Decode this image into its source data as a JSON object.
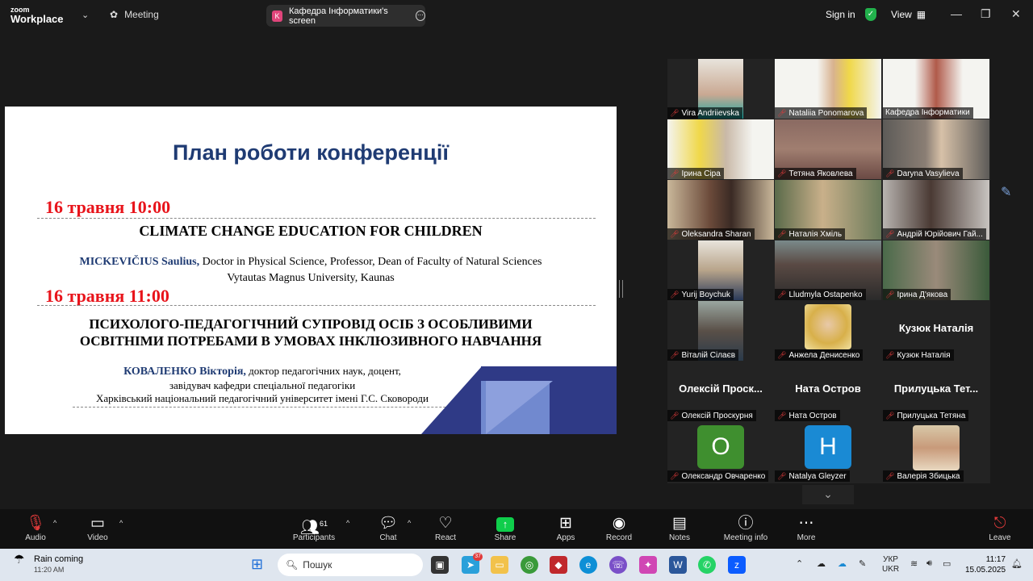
{
  "topbar": {
    "logo_line1": "zoom",
    "logo_line2": "Workplace",
    "meeting_label": "Meeting",
    "share_initial": "K",
    "share_label": "Кафедра Інформатики's screen",
    "signin": "Sign in",
    "view": "View"
  },
  "slide": {
    "title": "План роботи конференції",
    "date1": "16 травня  10:00",
    "talk1_title": "CLIMATE CHANGE EDUCATION FOR CHILDREN",
    "talk1_speaker": "MICKEVIČIUS Saulius,",
    "talk1_affil1": " Doctor in Physical Science, Professor, Dean of Faculty of Natural Sciences",
    "talk1_affil2": "Vytautas Magnus University, Kaunas",
    "date2": "16 травня  11:00",
    "talk2_title1": "ПСИХОЛОГО-ПЕДАГОГІЧНИЙ СУПРОВІД ОСІБ З ОСОБЛИВИМИ",
    "talk2_title2": "ОСВІТНІМИ ПОТРЕБАМИ В УМОВАХ ІНКЛЮЗИВНОГО НАВЧАННЯ",
    "talk2_speaker": "КОВАЛЕНКО Вікторія,",
    "talk2_affil1": " доктор педагогічних наук, доцент,",
    "talk2_affil2": "завідувач кафедри спеціальної педагогіки",
    "talk2_affil3": "Харківський національний педагогічний університет імені Г.С. Сковороди"
  },
  "gallery": {
    "tiles": [
      {
        "name": "Vira Andriievska"
      },
      {
        "name": "Nataliia Ponomarova"
      },
      {
        "name": "Кафедра Інформатики"
      },
      {
        "name": "Ірина Сіра"
      },
      {
        "name": "Тетяна Яковлева"
      },
      {
        "name": "Daryna Vasylieva"
      },
      {
        "name": "Oleksandra Sharan"
      },
      {
        "name": "Наталія Хміль"
      },
      {
        "name": "Андрій Юрійович Гай..."
      },
      {
        "name": "Yurij Boychuk"
      },
      {
        "name": "Lludmyla Ostapenko"
      },
      {
        "name": "Ірина Д'якова"
      },
      {
        "name": "Віталій Сілаєв"
      },
      {
        "name": "Анжела Денисенко"
      },
      {
        "name": "Кузюк Наталія",
        "big": "Кузюк Наталія"
      },
      {
        "name": "Олексій Проскурня",
        "big": "Олексій Проск..."
      },
      {
        "name": "Ната Остров",
        "big": "Ната Остров"
      },
      {
        "name": "Прилуцька Тетяна",
        "big": "Прилуцька Тет..."
      },
      {
        "name": "Олександр Овчаренко",
        "avatar": "O"
      },
      {
        "name": "Natalya Gleyzer",
        "avatar": "H"
      },
      {
        "name": "Валерія Збицька"
      }
    ]
  },
  "toolbar": {
    "audio": "Audio",
    "video": "Video",
    "participants": "Participants",
    "participants_count": "61",
    "chat": "Chat",
    "react": "React",
    "share": "Share",
    "apps": "Apps",
    "record": "Record",
    "notes": "Notes",
    "meeting_info": "Meeting info",
    "more": "More",
    "leave": "Leave"
  },
  "taskbar": {
    "weather_title": "Rain coming",
    "weather_time": "11:20 AM",
    "search_placeholder": "Пошук",
    "telegram_badge": "37",
    "lang1": "УКР",
    "lang2": "UKR",
    "time": "11:17",
    "date": "15.05.2025"
  },
  "colors": {
    "accent_green": "#23d18b",
    "slide_title": "#1f3b73",
    "slide_date": "#e8141b",
    "muted_mic": "#e03a3a"
  }
}
